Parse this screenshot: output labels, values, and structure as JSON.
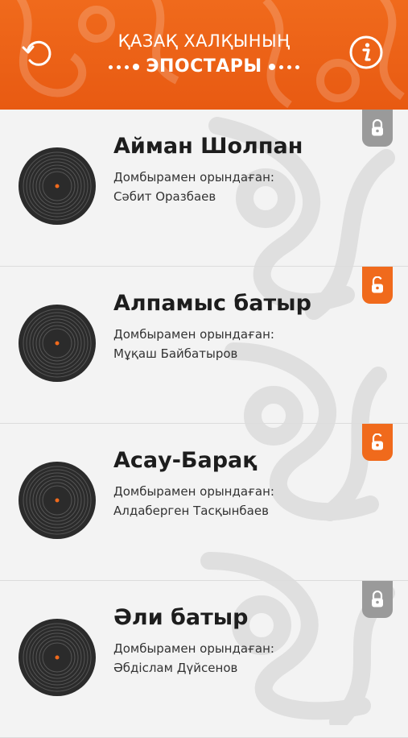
{
  "header": {
    "title_line1": "ҚАЗАҚ ХАЛҚЫНЫҢ",
    "title_line2": "ЭПОСТАРЫ",
    "refresh_icon": "refresh-icon",
    "info_icon": "info-icon"
  },
  "colors": {
    "accent": "#f06a1c",
    "lock_locked": "#9a9a9a",
    "lock_unlocked": "#f06a1c"
  },
  "items": [
    {
      "title": "Айман Шолпан",
      "performer_label": "Домбырамен орындаған:",
      "performer": "Сәбит Оразбаев",
      "lock": "locked"
    },
    {
      "title": "Алпамыс батыр",
      "performer_label": "Домбырамен орындаған:",
      "performer": "Мұқаш Байбатыров",
      "lock": "unlocked"
    },
    {
      "title": "Асау-Барақ",
      "performer_label": "Домбырамен орындаған:",
      "performer": "Алдаберген Тасқынбаев",
      "lock": "unlocked"
    },
    {
      "title": "Әли батыр",
      "performer_label": "Домбырамен орындаған:",
      "performer": "Әбдіслам Дүйсенов",
      "lock": "locked"
    }
  ]
}
